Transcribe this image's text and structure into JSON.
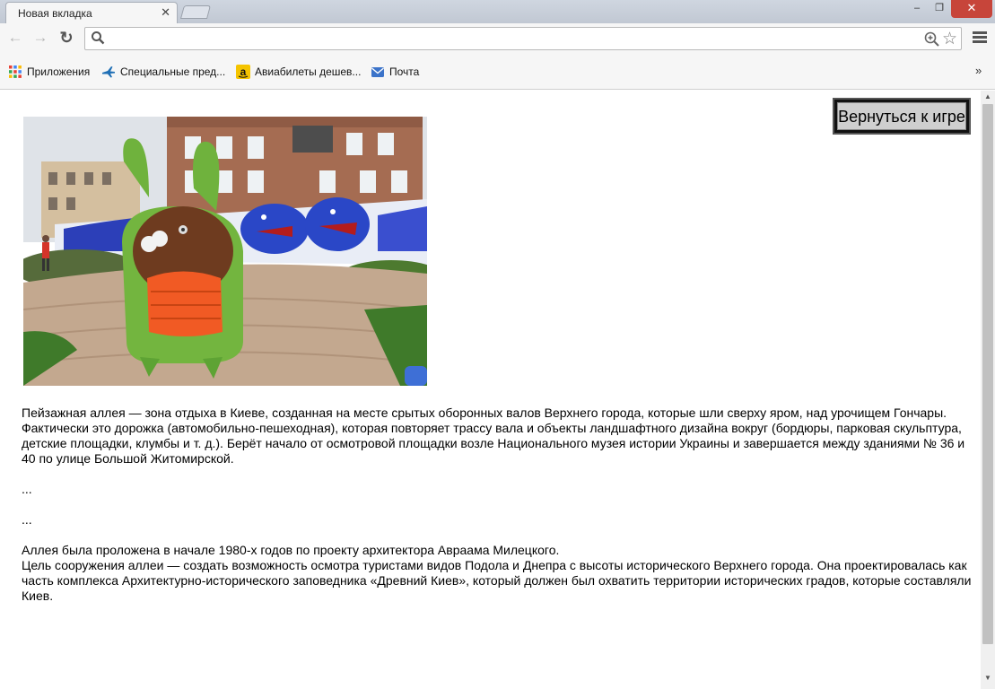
{
  "browser": {
    "tab_title": "Новая вкладка",
    "tab_close": "✕",
    "window_buttons": {
      "minimize": "–",
      "maximize": "❐",
      "close": "✕"
    },
    "address_value": "",
    "bookmarks": [
      {
        "label": "Приложения",
        "icon": "apps-grid-icon"
      },
      {
        "label": "Специальные пред...",
        "icon": "plane-icon"
      },
      {
        "label": "Авиабилеты дешев...",
        "icon": "amazon-icon"
      },
      {
        "label": "Почта",
        "icon": "mail-icon"
      }
    ],
    "bookmarks_more": "»"
  },
  "page": {
    "return_button": "Вернуться к игре",
    "photo_description_icon": "park-sculpture-photo",
    "paragraphs": [
      "Пейзажная аллея — зона отдыха в Киеве, созданная на месте срытых оборонных валов Верхнего города, которые шли сверху яром, над урочищем Гончары. Фактически это дорожка (автомобильно-пешеходная), которая повторяет трассу вала и объекты ландшафтного дизайна вокруг (бордюры, парковая скульптура, детские площадки, клумбы и т. д.). Берёт начало от осмотровой площадки возле Национального музея истории Украины и завершается между зданиями № 36 и 40 по улице Большой Житомирской.",
      "...",
      "...",
      "Аллея была проложена в начале 1980-х годов по проекту архитектора Авраама Милецкого.",
      "Цель сооружения аллеи — создать возможность осмотра туристами видов Подола и Днепра с высоты исторического Верхнего города. Она проектировалась как часть комплекса Архитектурно-исторического заповедника «Древний Киев», который должен был охватить территории исторических градов, которые составляли Киев."
    ]
  },
  "colors": {
    "close_button": "#c7453a",
    "toolbar_bg": "#f6f6f6",
    "return_button_frame": "#111111",
    "return_button_face": "#cfcfcf"
  }
}
